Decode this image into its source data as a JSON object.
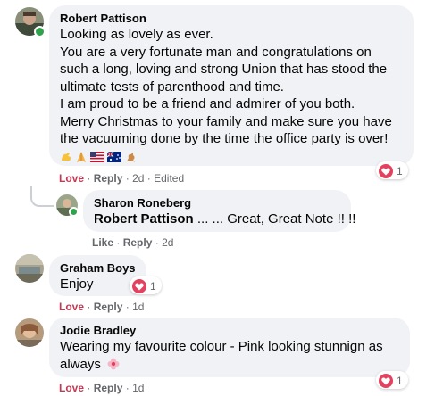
{
  "comments": [
    {
      "author": "Robert Pattison",
      "lines": [
        "Looking as lovely as ever.",
        "You are a very fortunate man and congratulations on",
        "such a long, loving and strong Union that has stood the",
        "ultimate tests of parenthood and time.",
        "I am proud to be a friend and admirer of you both.",
        "Merry Christmas to your family and make sure you have",
        "the vacuuming done by the time the office party is over!"
      ],
      "emojis": [
        "flexed-biceps",
        "folded-hands",
        "usa-flag",
        "australia-flag",
        "kangaroo"
      ],
      "love_label": "Love",
      "reply_label": "Reply",
      "time": "2d",
      "edited": "Edited",
      "reaction_count": "1"
    },
    {
      "author": "Sharon Roneberg",
      "mention": "Robert Pattison",
      "text": " ... ... Great, Great Note !! !!",
      "like_label": "Like",
      "reply_label": "Reply",
      "time": "2d"
    },
    {
      "author": "Graham Boys",
      "text": "Enjoy",
      "love_label": "Love",
      "reply_label": "Reply",
      "time": "1d",
      "reaction_count": "1"
    },
    {
      "author": "Jodie Bradley",
      "text": "Wearing my favourite colour - Pink looking stunnign as",
      "text2": "always",
      "love_label": "Love",
      "reply_label": "Reply",
      "time": "1d",
      "reaction_count": "1"
    }
  ],
  "separator": "·",
  "colors": {
    "bubble": "#f0f2f5",
    "love": "#c23a54",
    "meta": "#65676b",
    "heart": "#e4405f",
    "online": "#31a24c"
  }
}
